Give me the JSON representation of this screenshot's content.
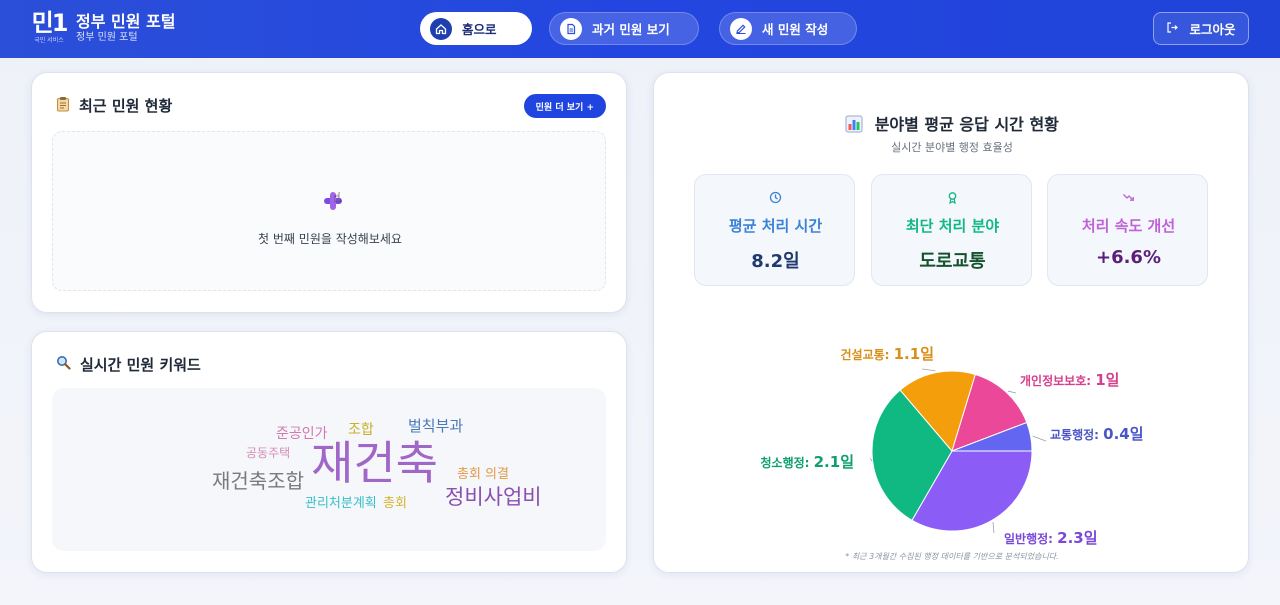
{
  "header": {
    "logo_mark": "민1",
    "logo_sub": "국민 서비스",
    "title": "정부 민원 포털",
    "subtitle": "정부 민원 포털",
    "nav": [
      {
        "label": "홈으로",
        "icon": "home-icon"
      },
      {
        "label": "과거 민원 보기",
        "icon": "document-icon"
      },
      {
        "label": "새 민원 작성",
        "icon": "edit-icon"
      }
    ],
    "logout_label": "로그아웃"
  },
  "recent": {
    "title": "최근 민원 현황",
    "more_label": "민원 더 보기 +",
    "empty_text": "첫 번째 민원을 작성해보세요"
  },
  "keywords": {
    "title": "실시간 민원 키워드",
    "words": [
      {
        "text": "준공인가",
        "color": "#d17bb0"
      },
      {
        "text": "조합",
        "color": "#c9b12a"
      },
      {
        "text": "벌칙부과",
        "color": "#4a78b8"
      },
      {
        "text": "공동주택",
        "color": "#d58bb8"
      },
      {
        "text": "재건축",
        "color": "#a067c8"
      },
      {
        "text": "재건축조합",
        "color": "#7a7a7a"
      },
      {
        "text": "총회 의결",
        "color": "#e39a4a"
      },
      {
        "text": "관리처분계획",
        "color": "#39bfc9"
      },
      {
        "text": "총회",
        "color": "#d4b62e"
      },
      {
        "text": "정비사업비",
        "color": "#8a4fb0"
      }
    ]
  },
  "stats": {
    "title": "분야별 평균 응답 시간 현황",
    "subtitle": "실시간 분야별 행정 효율성",
    "metrics": [
      {
        "label": "평균 처리 시간",
        "value": "8.2일",
        "icon": "clock-icon",
        "label_color": "#3b82d6",
        "value_color": "#1e3a6e"
      },
      {
        "label": "최단 처리 분야",
        "value": "도로교통",
        "icon": "award-icon",
        "label_color": "#10b981",
        "value_color": "#14532d"
      },
      {
        "label": "처리 속도 개선",
        "value": "+6.6%",
        "icon": "trend-down-icon",
        "label_color": "#c061d8",
        "value_color": "#5b1f7a"
      }
    ],
    "footnote": "* 최근 3개월간 수집된 행정 데이터를 기반으로 분석되었습니다."
  },
  "chart_data": {
    "type": "pie",
    "title": "",
    "unit": "일",
    "slices": [
      {
        "name": "일반행정",
        "value": 2.3,
        "label": "일반행정:",
        "value_label": "2.3일",
        "color": "#8b5cf6"
      },
      {
        "name": "청소행정",
        "value": 2.1,
        "label": "청소행정:",
        "value_label": "2.1일",
        "color": "#10b981"
      },
      {
        "name": "건설교통",
        "value": 1.1,
        "label": "건설교통:",
        "value_label": "1.1일",
        "color": "#f59e0b"
      },
      {
        "name": "개인정보보호",
        "value": 1.0,
        "label": "개인정보보호:",
        "value_label": "1일",
        "color": "#ec4899"
      },
      {
        "name": "교통행정",
        "value": 0.4,
        "label": "교통행정:",
        "value_label": "0.4일",
        "color": "#6366f1"
      }
    ]
  }
}
